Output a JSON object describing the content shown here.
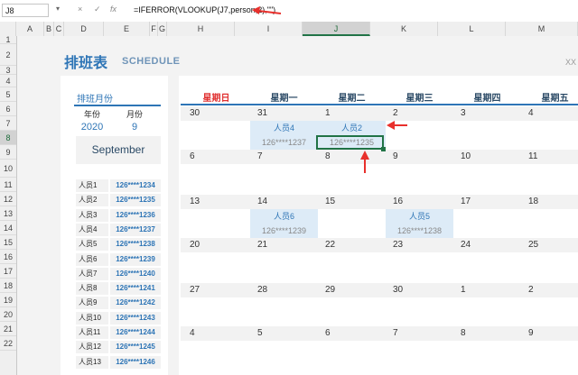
{
  "formula_bar": {
    "cell_ref": "J8",
    "cancel_icon": "×",
    "enter_icon": "✓",
    "fx_icon": "fx",
    "formula": "=IFERROR(VLOOKUP(J7,person,2),\"\")"
  },
  "columns": [
    "A",
    "B",
    "C",
    "D",
    "E",
    "F",
    "G",
    "H",
    "I",
    "J",
    "K",
    "L",
    "M"
  ],
  "rows": [
    "1",
    "2",
    "3",
    "4",
    "5",
    "6",
    "7",
    "8",
    "9",
    "10",
    "11",
    "12",
    "13",
    "14",
    "15",
    "16",
    "17",
    "18",
    "19",
    "20",
    "21",
    "22"
  ],
  "selected": {
    "column": "J",
    "row": "8"
  },
  "header": {
    "title": "排班表",
    "subtitle": "SCHEDULE",
    "corner": "XX"
  },
  "month_panel": {
    "label": "排班月份",
    "year_label": "年份",
    "month_label": "月份",
    "year": "2020",
    "month": "9",
    "month_name": "September"
  },
  "people": [
    {
      "name": "人员1",
      "phone": "126****1234"
    },
    {
      "name": "人员2",
      "phone": "126****1235"
    },
    {
      "name": "人员3",
      "phone": "126****1236"
    },
    {
      "name": "人员4",
      "phone": "126****1237"
    },
    {
      "name": "人员5",
      "phone": "126****1238"
    },
    {
      "name": "人员6",
      "phone": "126****1239"
    },
    {
      "name": "人员7",
      "phone": "126****1240"
    },
    {
      "name": "人员8",
      "phone": "126****1241"
    },
    {
      "name": "人员9",
      "phone": "126****1242"
    },
    {
      "name": "人员10",
      "phone": "126****1243"
    },
    {
      "name": "人员11",
      "phone": "126****1244"
    },
    {
      "name": "人员12",
      "phone": "126****1245"
    },
    {
      "name": "人员13",
      "phone": "126****1246"
    }
  ],
  "weekdays": [
    "星期日",
    "星期一",
    "星期二",
    "星期三",
    "星期四",
    "星期五"
  ],
  "weeks": [
    [
      "30",
      "31",
      "1",
      "2",
      "3",
      "4"
    ],
    [
      "6",
      "7",
      "8",
      "9",
      "10",
      "11"
    ],
    [
      "13",
      "14",
      "15",
      "16",
      "17",
      "18"
    ],
    [
      "20",
      "21",
      "22",
      "23",
      "24",
      "25"
    ],
    [
      "27",
      "28",
      "29",
      "30",
      "1",
      "2"
    ],
    [
      "4",
      "5",
      "6",
      "7",
      "8",
      "9"
    ]
  ],
  "assignments": [
    {
      "week": 0,
      "day": 1,
      "name": "人员4",
      "phone": "126****1237"
    },
    {
      "week": 0,
      "day": 2,
      "name": "人员2",
      "phone": "126****1235"
    },
    {
      "week": 2,
      "day": 1,
      "name": "人员6",
      "phone": "126****1239"
    },
    {
      "week": 2,
      "day": 3,
      "name": "人员5",
      "phone": "126****1238"
    }
  ],
  "colors": {
    "accent": "#2e75b6",
    "sunday": "#e03030",
    "assign_bg": "#ddebf7",
    "selection": "#217346",
    "annotation": "#e8302c"
  }
}
